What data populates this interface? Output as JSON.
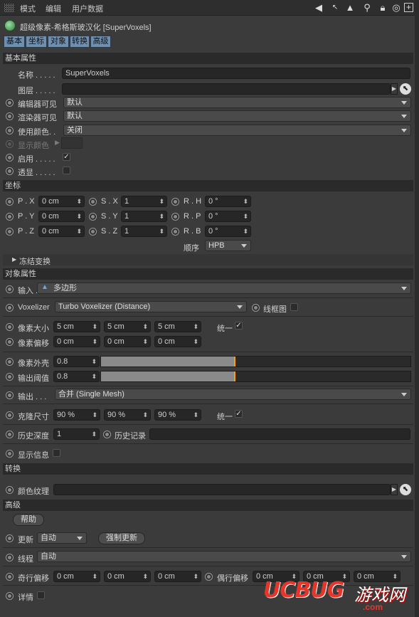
{
  "menu": {
    "mode": "模式",
    "edit": "编辑",
    "userdata": "用户数据"
  },
  "title": "超级像素-希格斯玻汉化 [SuperVoxels]",
  "tabs": [
    "基本",
    "坐标",
    "对象",
    "转换",
    "高级"
  ],
  "sections": {
    "basic": "基本属性",
    "coord": "坐标",
    "freeze": "冻结变换",
    "object": "对象属性",
    "convert": "转换",
    "advanced": "高级"
  },
  "basic": {
    "name_label": "名称 . . . . .",
    "name_value": "SuperVoxels",
    "layer_label": "图层 . . . . .",
    "editor_vis_label": "编辑器可见",
    "editor_vis_value": "默认",
    "render_vis_label": "渲染器可见",
    "render_vis_value": "默认",
    "use_color_label": "使用颜色. .",
    "use_color_value": "关闭",
    "display_color_label": "显示颜色",
    "enabled_label": "启用 . . . . .",
    "enabled_mark": "✓",
    "xray_label": "透显 . . . . ."
  },
  "coord": {
    "px_label": "P . X",
    "px": "0 cm",
    "py_label": "P . Y",
    "py": "0 cm",
    "pz_label": "P . Z",
    "pz": "0 cm",
    "sx_label": "S . X",
    "sx": "1",
    "sy_label": "S . Y",
    "sy": "1",
    "sz_label": "S . Z",
    "sz": "1",
    "rh_label": "R . H",
    "rh": "0 °",
    "rp_label": "R . P",
    "rp": "0 °",
    "rb_label": "R . B",
    "rb": "0 °",
    "order_label": "顺序",
    "order": "HPB"
  },
  "object": {
    "input_label": "输入 . .",
    "input_value": "多边形",
    "voxelizer_label": "Voxelizer",
    "voxelizer_value": "Turbo Voxelizer (Distance)",
    "wireframe_label": "线框图",
    "voxel_size_label": "像素大小",
    "voxel_size": [
      "5 cm",
      "5 cm",
      "5 cm"
    ],
    "uniform_label": "统一",
    "uniform_mark": "✓",
    "voxel_offset_label": "像素偏移",
    "voxel_offset": [
      "0 cm",
      "0 cm",
      "0 cm"
    ],
    "shell_label": "像素外壳",
    "shell_value": "0.8",
    "shell_fill": 0.8,
    "threshold_label": "输出阈值",
    "threshold_value": "0.8",
    "threshold_fill": 0.8,
    "output_label": "输出 . . .",
    "output_value": "合并 (Single Mesh)",
    "clone_size_label": "克隆尺寸",
    "clone_size": [
      "90 %",
      "90 %",
      "90 %"
    ],
    "uniform2_label": "统一",
    "uniform2_mark": "✓",
    "history_depth_label": "历史深度",
    "history_depth": "1",
    "history_record_label": "历史记录",
    "show_info_label": "显示信息"
  },
  "convert": {
    "color_texture_label": "颜色纹理"
  },
  "advanced": {
    "help_label": "帮助",
    "update_label": "更新",
    "update_value": "自动",
    "force_update_label": "强制更新",
    "thread_label": "线程",
    "thread_value": "自动",
    "odd_offset_label": "奇行偏移",
    "odd_offset": [
      "0 cm",
      "0 cm",
      "0 cm"
    ],
    "even_offset_label": "偶行偏移",
    "even_offset": [
      "0 cm",
      "0 cm",
      "0 cm"
    ],
    "details_label": "详情"
  },
  "watermark": {
    "brand": "UCBUG",
    "cn": "游戏网",
    "url": ".com"
  }
}
